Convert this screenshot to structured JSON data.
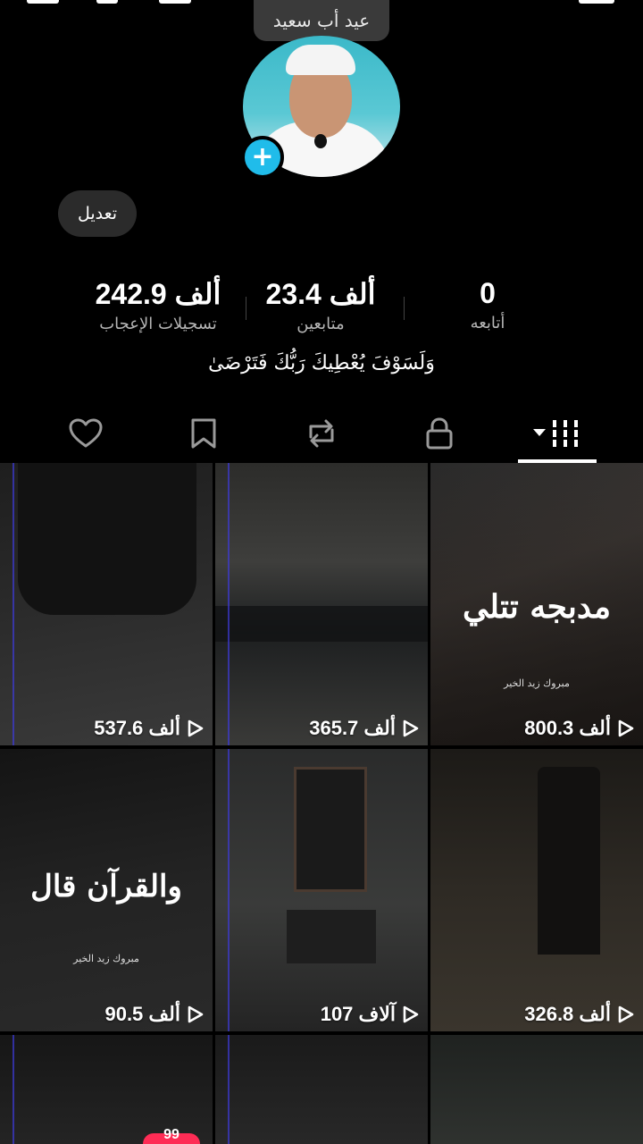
{
  "profile": {
    "display_name": "عيد أب سعيد",
    "edit_label": "تعديل",
    "bio": "وَلَسَوْفَ يُعْطِيكَ رَبُّكَ فَتَرْضَىٰ"
  },
  "stats": {
    "following": {
      "value": "0",
      "label": "أتابعه"
    },
    "followers": {
      "value": "23.4 ألف",
      "label": "متابعين"
    },
    "likes": {
      "value": "242.9 ألف",
      "label": "تسجيلات الإعجاب"
    }
  },
  "tabs": [
    {
      "icon": "videos-grid-icon",
      "active": true
    },
    {
      "icon": "lock-icon",
      "active": false
    },
    {
      "icon": "repost-icon",
      "active": false
    },
    {
      "icon": "bookmark-icon",
      "active": false
    },
    {
      "icon": "heart-icon",
      "active": false
    }
  ],
  "videos": [
    {
      "views": "800.3 ألف",
      "title": "مدبجه تتلي",
      "caption": "مبروك زيد الخير"
    },
    {
      "views": "365.7 ألف",
      "title": "",
      "caption": ""
    },
    {
      "views": "537.6 ألف",
      "title": "",
      "caption": ""
    },
    {
      "views": "326.8 ألف",
      "title": "",
      "caption": ""
    },
    {
      "views": "107 آلاف",
      "title": "",
      "caption": ""
    },
    {
      "views": "90.5 ألف",
      "title": "والقرآن قال",
      "caption": "مبروك زيد الخير"
    }
  ],
  "colors": {
    "accent_blue": "#20bcea",
    "badge_red": "#fe2c55"
  },
  "notification_badge": "99"
}
